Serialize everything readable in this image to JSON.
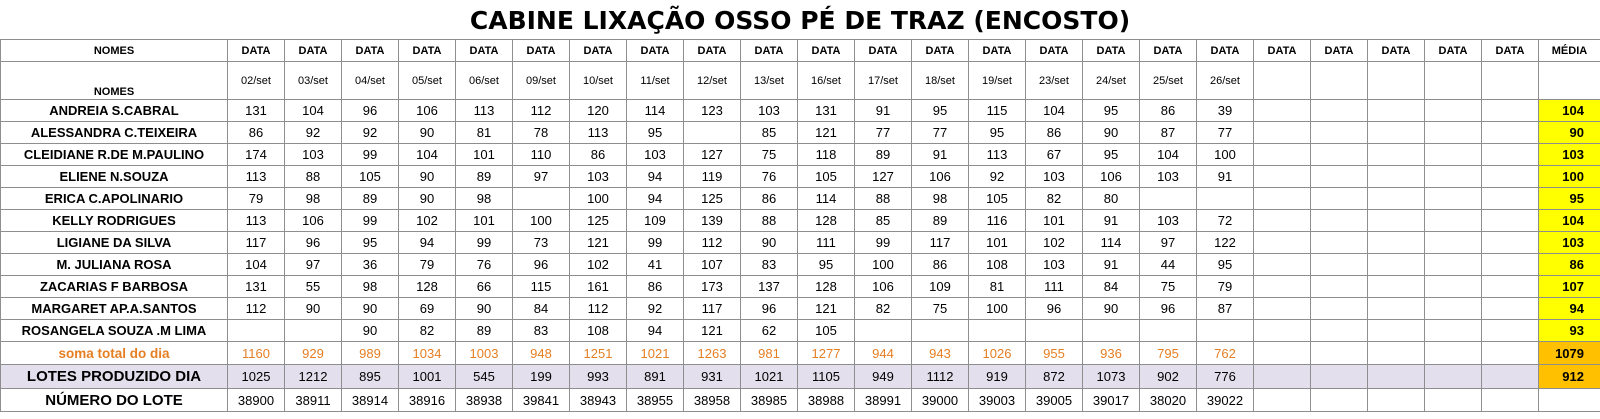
{
  "title": "CABINE LIXAÇÃO OSSO PÉ DE TRAZ (ENCOSTO)",
  "header": {
    "names_label": "NOMES",
    "data_label": "DATA",
    "media_label": "MÉDIA",
    "dates": [
      "02/set",
      "03/set",
      "04/set",
      "05/set",
      "06/set",
      "09/set",
      "10/set",
      "11/set",
      "12/set",
      "13/set",
      "16/set",
      "17/set",
      "18/set",
      "19/set",
      "23/set",
      "24/set",
      "25/set",
      "26/set",
      "",
      "",
      "",
      "",
      ""
    ]
  },
  "rows": [
    {
      "name": "ANDREIA S.CABRAL",
      "values": [
        "131",
        "104",
        "96",
        "106",
        "113",
        "112",
        "120",
        "114",
        "123",
        "103",
        "131",
        "91",
        "95",
        "115",
        "104",
        "95",
        "86",
        "39",
        "",
        "",
        "",
        "",
        ""
      ],
      "media": "104"
    },
    {
      "name": "ALESSANDRA C.TEIXEIRA",
      "values": [
        "86",
        "92",
        "92",
        "90",
        "81",
        "78",
        "113",
        "95",
        "",
        "85",
        "121",
        "77",
        "77",
        "95",
        "86",
        "90",
        "87",
        "77",
        "",
        "",
        "",
        "",
        ""
      ],
      "media": "90"
    },
    {
      "name": "CLEIDIANE R.DE M.PAULINO",
      "values": [
        "174",
        "103",
        "99",
        "104",
        "101",
        "110",
        "86",
        "103",
        "127",
        "75",
        "118",
        "89",
        "91",
        "113",
        "67",
        "95",
        "104",
        "100",
        "",
        "",
        "",
        "",
        ""
      ],
      "media": "103"
    },
    {
      "name": "ELIENE N.SOUZA",
      "values": [
        "113",
        "88",
        "105",
        "90",
        "89",
        "97",
        "103",
        "94",
        "119",
        "76",
        "105",
        "127",
        "106",
        "92",
        "103",
        "106",
        "103",
        "91",
        "",
        "",
        "",
        "",
        ""
      ],
      "media": "100"
    },
    {
      "name": "ERICA C.APOLINARIO",
      "values": [
        "79",
        "98",
        "89",
        "90",
        "98",
        "",
        "100",
        "94",
        "125",
        "86",
        "114",
        "88",
        "98",
        "105",
        "82",
        "80",
        "",
        "",
        "",
        "",
        "",
        "",
        ""
      ],
      "media": "95"
    },
    {
      "name": "KELLY RODRIGUES",
      "values": [
        "113",
        "106",
        "99",
        "102",
        "101",
        "100",
        "125",
        "109",
        "139",
        "88",
        "128",
        "85",
        "89",
        "116",
        "101",
        "91",
        "103",
        "72",
        "",
        "",
        "",
        "",
        ""
      ],
      "media": "104"
    },
    {
      "name": "LIGIANE DA SILVA",
      "values": [
        "117",
        "96",
        "95",
        "94",
        "99",
        "73",
        "121",
        "99",
        "112",
        "90",
        "111",
        "99",
        "117",
        "101",
        "102",
        "114",
        "97",
        "122",
        "",
        "",
        "",
        "",
        ""
      ],
      "media": "103"
    },
    {
      "name": "M. JULIANA ROSA",
      "values": [
        "104",
        "97",
        "36",
        "79",
        "76",
        "96",
        "102",
        "41",
        "107",
        "83",
        "95",
        "100",
        "86",
        "108",
        "103",
        "91",
        "44",
        "95",
        "",
        "",
        "",
        "",
        ""
      ],
      "media": "86"
    },
    {
      "name": "ZACARIAS F BARBOSA",
      "values": [
        "131",
        "55",
        "98",
        "128",
        "66",
        "115",
        "161",
        "86",
        "173",
        "137",
        "128",
        "106",
        "109",
        "81",
        "111",
        "84",
        "75",
        "79",
        "",
        "",
        "",
        "",
        ""
      ],
      "media": "107"
    },
    {
      "name": "MARGARET AP.A.SANTOS",
      "values": [
        "112",
        "90",
        "90",
        "69",
        "90",
        "84",
        "112",
        "92",
        "117",
        "96",
        "121",
        "82",
        "75",
        "100",
        "96",
        "90",
        "96",
        "87",
        "",
        "",
        "",
        "",
        ""
      ],
      "media": "94"
    },
    {
      "name": "ROSANGELA SOUZA .M LIMA",
      "values": [
        "",
        "",
        "90",
        "82",
        "89",
        "83",
        "108",
        "94",
        "121",
        "62",
        "105",
        "",
        "",
        "",
        "",
        "",
        "",
        "",
        "",
        "",
        "",
        "",
        ""
      ],
      "media": "93"
    }
  ],
  "sum_row": {
    "label": "soma total  do dia",
    "values": [
      "1160",
      "929",
      "989",
      "1034",
      "1003",
      "948",
      "1251",
      "1021",
      "1263",
      "981",
      "1277",
      "944",
      "943",
      "1026",
      "955",
      "936",
      "795",
      "762",
      "",
      "",
      "",
      "",
      ""
    ],
    "media": "1079"
  },
  "lotes_row": {
    "label": "LOTES PRODUZIDO DIA",
    "values": [
      "1025",
      "1212",
      "895",
      "1001",
      "545",
      "199",
      "993",
      "891",
      "931",
      "1021",
      "1105",
      "949",
      "1112",
      "919",
      "872",
      "1073",
      "902",
      "776",
      "",
      "",
      "",
      "",
      ""
    ],
    "media": "912"
  },
  "numero_row": {
    "label": "NÚMERO DO LOTE",
    "values": [
      "38900",
      "38911",
      "38914",
      "38916",
      "38938",
      "39841",
      "38943",
      "38955",
      "38958",
      "38985",
      "38988",
      "38991",
      "39000",
      "39003",
      "39005",
      "39017",
      "38020",
      "39022",
      "",
      "",
      "",
      "",
      ""
    ],
    "media": ""
  },
  "colors": {
    "media_highlight": "#ffff00",
    "total_highlight": "#ffc000",
    "sum_text": "#e67e22",
    "lotes_background": "#e4dfec"
  }
}
